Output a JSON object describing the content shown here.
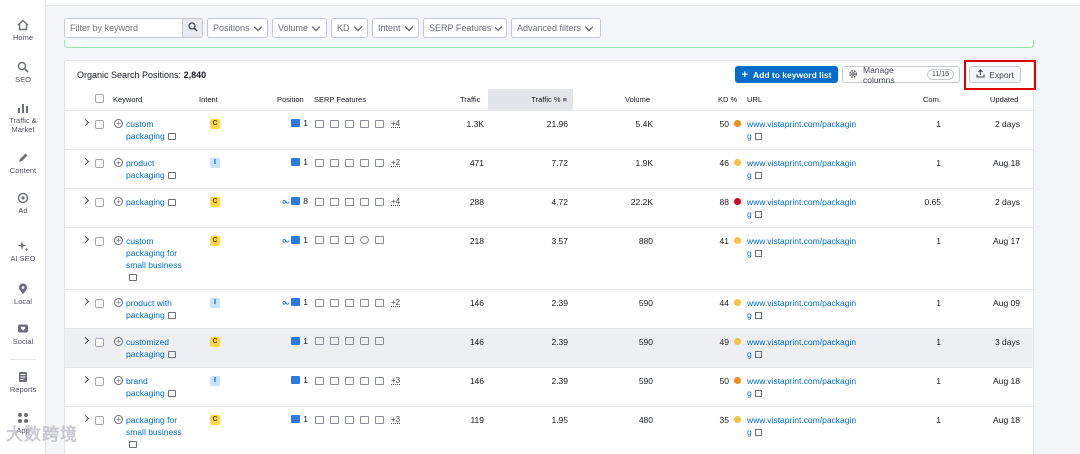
{
  "sidebar": {
    "items": [
      {
        "label": "Home",
        "icon": "home-icon"
      },
      {
        "label": "SEO",
        "icon": "seo-icon"
      },
      {
        "label": "Traffic & Market",
        "icon": "chart-bars-icon"
      },
      {
        "label": "Content",
        "icon": "pen-icon"
      },
      {
        "label": "Ad",
        "icon": "target-icon"
      },
      {
        "label": "AI SEO",
        "icon": "sparkle-icon"
      },
      {
        "label": "Local",
        "icon": "pin-icon"
      },
      {
        "label": "Social",
        "icon": "heart-icon"
      },
      {
        "label": "Reports",
        "icon": "document-icon"
      },
      {
        "label": "App",
        "icon": "apps-icon"
      }
    ]
  },
  "filters": {
    "search_placeholder": "Filter by keyword",
    "positions": "Positions",
    "volume": "Volume",
    "kd": "KD",
    "intent": "Intent",
    "serp": "SERP Features",
    "advanced": "Advanced filters"
  },
  "panel": {
    "title": "Organic Search Positions:",
    "count": "2,840",
    "add_button": "Add to keyword list",
    "manage_columns": "Manage columns",
    "columns_badge": "11/15",
    "export": "Export"
  },
  "table": {
    "headers": {
      "keyword": "Keyword",
      "intent": "Intent",
      "position": "Position",
      "serp": "SERP Features",
      "traffic": "Traffic",
      "traffic_pct": "Traffic %",
      "volume": "Volume",
      "kd": "KD %",
      "url": "URL",
      "com": "Com.",
      "updated": "Updated"
    },
    "rows": [
      {
        "keyword": "custom packaging",
        "intent": "C",
        "position": "1",
        "pos_link": false,
        "more": "+4",
        "traffic": "1.3K",
        "traffic_pct": "21.96",
        "volume": "5.4K",
        "kd": "50",
        "kd_color": "#ef8a1c",
        "url": "www.vistaprint.com/packaging",
        "com": "1",
        "updated": "2 days"
      },
      {
        "keyword": "product packaging",
        "intent": "I",
        "position": "1",
        "pos_link": false,
        "more": "+2",
        "traffic": "471",
        "traffic_pct": "7.72",
        "volume": "1.9K",
        "kd": "46",
        "kd_color": "#f5c242",
        "url": "www.vistaprint.com/packaging",
        "com": "1",
        "updated": "Aug 18"
      },
      {
        "keyword": "packaging",
        "intent": "C",
        "position": "8",
        "pos_link": true,
        "more": "+4",
        "traffic": "288",
        "traffic_pct": "4.72",
        "volume": "22.2K",
        "kd": "88",
        "kd_color": "#d1002f",
        "url": "www.vistaprint.com/packaging",
        "com": "0.65",
        "updated": "2 days"
      },
      {
        "keyword": "custom packaging for small business",
        "intent": "C",
        "position": "1",
        "pos_link": true,
        "more": "",
        "traffic": "218",
        "traffic_pct": "3.57",
        "volume": "880",
        "kd": "41",
        "kd_color": "#f5c242",
        "url": "www.vistaprint.com/packaging",
        "com": "1",
        "updated": "Aug 17"
      },
      {
        "keyword": "product with packaging",
        "intent": "I",
        "position": "1",
        "pos_link": true,
        "more": "+2",
        "traffic": "146",
        "traffic_pct": "2.39",
        "volume": "590",
        "kd": "44",
        "kd_color": "#f5c242",
        "url": "www.vistaprint.com/packaging",
        "com": "1",
        "updated": "Aug 09"
      },
      {
        "keyword": "customized packaging",
        "intent": "C",
        "position": "1",
        "pos_link": false,
        "more": "",
        "traffic": "146",
        "traffic_pct": "2.39",
        "volume": "590",
        "kd": "49",
        "kd_color": "#f5c242",
        "url": "www.vistaprint.com/packaging",
        "com": "1",
        "updated": "3 days"
      },
      {
        "keyword": "brand packaging",
        "intent": "I",
        "position": "1",
        "pos_link": false,
        "more": "+3",
        "traffic": "146",
        "traffic_pct": "2.39",
        "volume": "590",
        "kd": "50",
        "kd_color": "#ef8a1c",
        "url": "www.vistaprint.com/packaging",
        "com": "1",
        "updated": "Aug 18"
      },
      {
        "keyword": "packaging for small business",
        "intent": "C",
        "position": "1",
        "pos_link": false,
        "more": "+3",
        "traffic": "119",
        "traffic_pct": "1.95",
        "volume": "480",
        "kd": "35",
        "kd_color": "#f5c242",
        "url": "www.vistaprint.com/packaging",
        "com": "1",
        "updated": "Aug 18"
      }
    ]
  },
  "watermark": "大数跨境"
}
